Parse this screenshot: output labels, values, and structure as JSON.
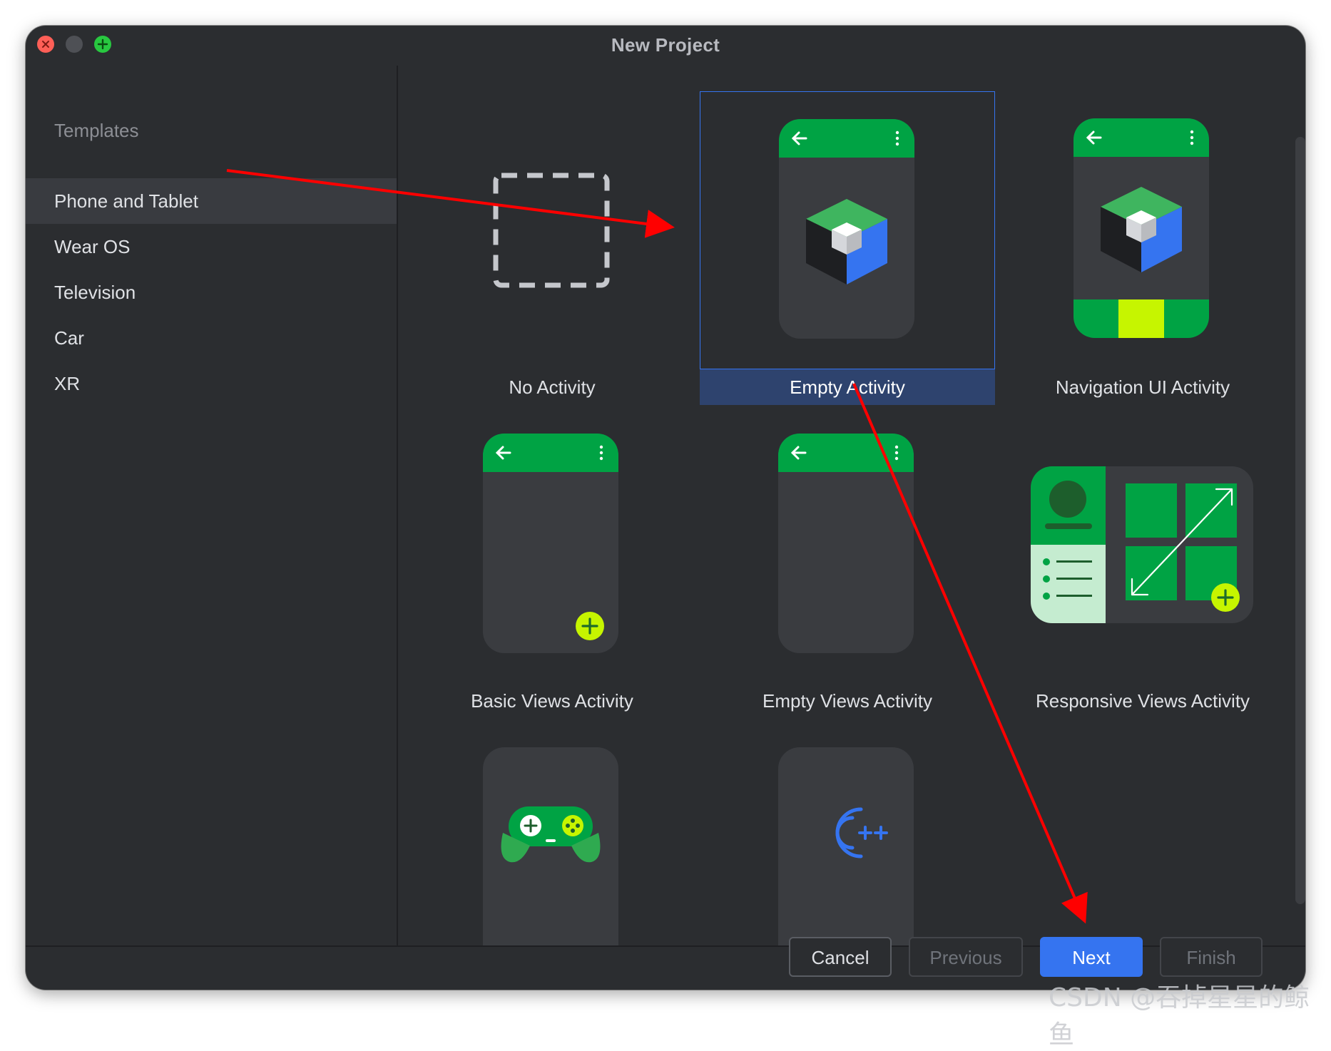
{
  "window": {
    "title": "New Project"
  },
  "sidebar": {
    "header": "Templates",
    "items": [
      {
        "label": "Phone and Tablet",
        "selected": true
      },
      {
        "label": "Wear OS",
        "selected": false
      },
      {
        "label": "Television",
        "selected": false
      },
      {
        "label": "Car",
        "selected": false
      },
      {
        "label": "XR",
        "selected": false
      }
    ]
  },
  "templates": [
    {
      "label": "No Activity",
      "icon": "dashed-square-icon",
      "selected": false
    },
    {
      "label": "Empty Activity",
      "icon": "compose-cube-icon",
      "selected": true
    },
    {
      "label": "Navigation UI Activity",
      "icon": "compose-cube-bottom-nav-icon",
      "selected": false
    },
    {
      "label": "Basic Views Activity",
      "icon": "fab-plus-icon",
      "selected": false
    },
    {
      "label": "Empty Views Activity",
      "icon": "blank-phone-icon",
      "selected": false
    },
    {
      "label": "Responsive Views Activity",
      "icon": "responsive-layout-icon",
      "selected": false
    },
    {
      "label": "",
      "icon": "gamepad-icon",
      "selected": false
    },
    {
      "label": "",
      "icon": "cpp-icon",
      "selected": false
    }
  ],
  "footer": {
    "cancel": "Cancel",
    "previous": "Previous",
    "next": "Next",
    "finish": "Finish"
  },
  "colors": {
    "accent": "#3574f0",
    "android_green": "#00a344",
    "lime": "#c6f500",
    "annotation_red": "#ff0000"
  },
  "watermark": "CSDN @吞掉星星的鲸鱼"
}
